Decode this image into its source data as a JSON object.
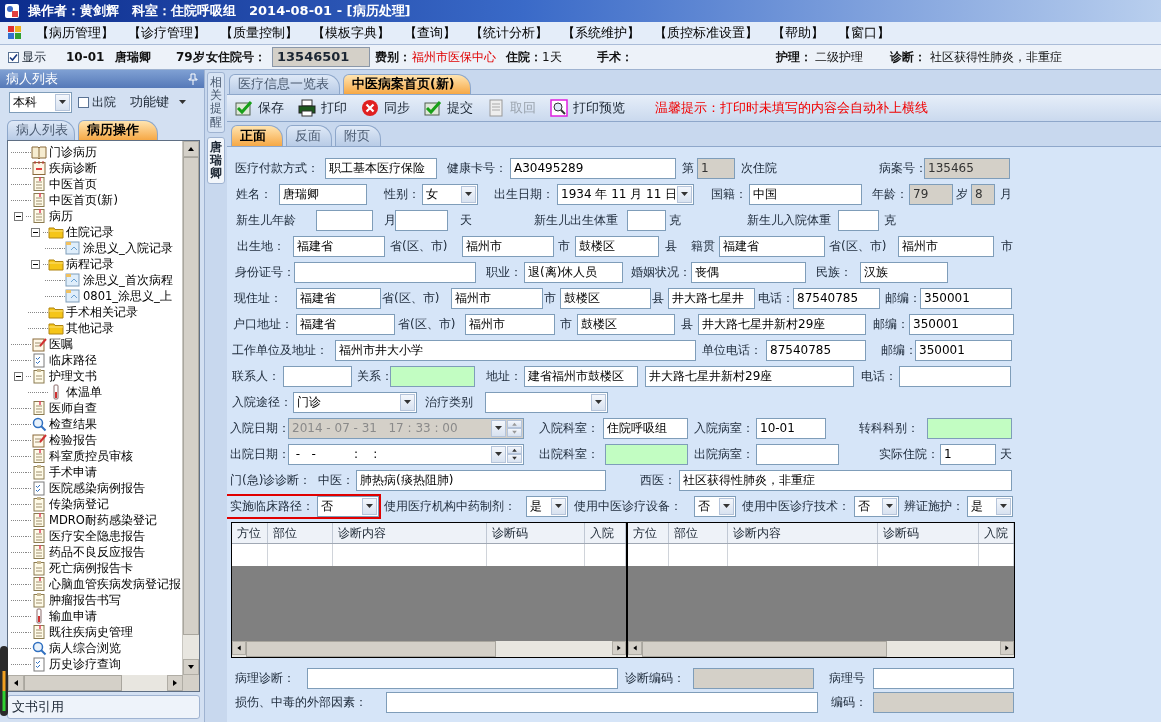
{
  "title_bar": {
    "title": "操作者：黄剑辉　科室：住院呼吸组　2014-08-01 - [病历处理]"
  },
  "menu": [
    "【病历管理】",
    "【诊疗管理】",
    "【质量控制】",
    "【模板字典】",
    "【查询】",
    "【统计分析】",
    "【系统维护】",
    "【质控标准设置】",
    "【帮助】",
    "【窗口】"
  ],
  "patient_bar": {
    "show": {
      "label": "显示",
      "checked": true
    },
    "items": [
      {
        "kind": "label",
        "text": "10-01"
      },
      {
        "kind": "label",
        "text": "唐瑞卿"
      },
      {
        "kind": "label",
        "text": "79岁"
      },
      {
        "kind": "label",
        "text": "女"
      },
      {
        "kind": "label",
        "text": "住院号："
      },
      {
        "kind": "field",
        "text": "13546501"
      },
      {
        "kind": "label",
        "text": "费别："
      },
      {
        "kind": "alert",
        "text": "福州市医保中心"
      },
      {
        "kind": "label",
        "text": "住院："
      },
      {
        "kind": "value",
        "text": "1天"
      },
      {
        "kind": "label",
        "text": "手术："
      },
      {
        "kind": "label",
        "text": "护理："
      },
      {
        "kind": "value",
        "text": "二级护理"
      },
      {
        "kind": "label",
        "text": "诊断："
      },
      {
        "kind": "value",
        "text": "社区获得性肺炎，非重症"
      }
    ]
  },
  "sidebar": {
    "title": "病人列表",
    "filter": {
      "value": "本科"
    },
    "discharged": {
      "label": "出院",
      "checked": false
    },
    "function_key": "功能键",
    "tabs": [
      {
        "label": "病人列表",
        "selected": false
      },
      {
        "label": "病历操作",
        "selected": true
      }
    ],
    "tree": [
      {
        "label": "门诊病历",
        "kind": "book"
      },
      {
        "label": "疾病诊断",
        "kind": "calendar"
      },
      {
        "label": "中医首页",
        "kind": "document"
      },
      {
        "label": "中医首页(新)",
        "kind": "document"
      },
      {
        "label": "病历",
        "kind": "document",
        "expanded": true,
        "children": [
          {
            "label": "住院记录",
            "kind": "folder",
            "expanded": true,
            "children": [
              {
                "label": "涂思义_入院记录",
                "kind": "file"
              }
            ]
          },
          {
            "label": "病程记录",
            "kind": "folder",
            "expanded": true,
            "children": [
              {
                "label": "涂思义_首次病程",
                "kind": "file"
              },
              {
                "label": "0801_涂思义_上",
                "kind": "file"
              }
            ]
          },
          {
            "label": "手术相关记录",
            "kind": "folder"
          },
          {
            "label": "其他记录",
            "kind": "folder"
          }
        ]
      },
      {
        "label": "医嘱",
        "kind": "notepad"
      },
      {
        "label": "临床路径",
        "kind": "checklist"
      },
      {
        "label": "护理文书",
        "kind": "clipboard",
        "expanded": true,
        "children": [
          {
            "label": "体温单",
            "kind": "vial"
          }
        ]
      },
      {
        "label": "医师自查",
        "kind": "document"
      },
      {
        "label": "检查结果",
        "kind": "magnifier"
      },
      {
        "label": "检验报告",
        "kind": "notepad"
      },
      {
        "label": "科室质控员审核",
        "kind": "document"
      },
      {
        "label": "手术申请",
        "kind": "clipboard"
      },
      {
        "label": "医院感染病例报告",
        "kind": "checklist"
      },
      {
        "label": "传染病登记",
        "kind": "clipboard"
      },
      {
        "label": "MDRO耐药感染登记",
        "kind": "document"
      },
      {
        "label": "医疗安全隐患报告",
        "kind": "document"
      },
      {
        "label": "药品不良反应报告",
        "kind": "document"
      },
      {
        "label": "死亡病例报告卡",
        "kind": "clipboard"
      },
      {
        "label": "心脑血管疾病发病登记报",
        "kind": "document"
      },
      {
        "label": "肿瘤报告书写",
        "kind": "clipboard"
      },
      {
        "label": "输血申请",
        "kind": "vial"
      },
      {
        "label": "既往疾病史管理",
        "kind": "document"
      },
      {
        "label": "病人综合浏览",
        "kind": "magnifier"
      },
      {
        "label": "历史诊疗查询",
        "kind": "checklist"
      }
    ],
    "footer": "文书引用"
  },
  "vertical_tabs": [
    {
      "label": "相关提醒",
      "selected": false
    },
    {
      "label": "唐瑞卿",
      "selected": true
    }
  ],
  "doc_tabs": [
    {
      "label": "医疗信息一览表",
      "selected": false
    },
    {
      "label": "中医病案首页(新)",
      "selected": true
    }
  ],
  "toolbar": {
    "buttons": [
      {
        "kind": "save",
        "label": "保存",
        "disabled": false
      },
      {
        "kind": "print",
        "label": "打印",
        "disabled": false
      },
      {
        "kind": "sync",
        "label": "同步",
        "disabled": false
      },
      {
        "kind": "submit",
        "label": "提交",
        "disabled": false
      },
      {
        "kind": "withdraw",
        "label": "取回",
        "disabled": true
      },
      {
        "kind": "preview",
        "label": "打印预览",
        "disabled": false
      }
    ],
    "tip": "温馨提示：打印时未填写的内容会自动补上横线"
  },
  "page_tabs": [
    {
      "label": "正面",
      "selected": true
    },
    {
      "label": "反面",
      "selected": false
    },
    {
      "label": "附页",
      "selected": false
    }
  ],
  "form": {
    "rows": [
      {
        "items": [
          {
            "kind": "label",
            "text": "医疗付款方式："
          },
          {
            "kind": "text",
            "value": "职工基本医疗保险"
          },
          {
            "kind": "label",
            "text": "健康卡号："
          },
          {
            "kind": "text",
            "value": "A30495289"
          },
          {
            "kind": "label",
            "text": "第"
          },
          {
            "kind": "readonly",
            "value": "1"
          },
          {
            "kind": "label",
            "text": "次住院"
          },
          {
            "kind": "label",
            "text": "病案号："
          },
          {
            "kind": "readonly",
            "value": "135465"
          }
        ]
      },
      {
        "items": [
          {
            "kind": "label",
            "text": "姓名："
          },
          {
            "kind": "text",
            "value": "唐瑞卿"
          },
          {
            "kind": "label",
            "text": "性别："
          },
          {
            "kind": "select",
            "value": "女"
          },
          {
            "kind": "label",
            "text": "出生日期："
          },
          {
            "kind": "select",
            "value": "1934 年 11 月 11 日"
          },
          {
            "kind": "label",
            "text": "国籍："
          },
          {
            "kind": "text",
            "value": "中国"
          },
          {
            "kind": "label",
            "text": "年龄："
          },
          {
            "kind": "readonly",
            "value": "79"
          },
          {
            "kind": "label",
            "text": "岁"
          },
          {
            "kind": "readonly",
            "value": "8"
          },
          {
            "kind": "label",
            "text": "月"
          }
        ]
      },
      {
        "items": [
          {
            "kind": "label",
            "text": "新生儿年龄"
          },
          {
            "kind": "text"
          },
          {
            "kind": "label",
            "text": "月"
          },
          {
            "kind": "text"
          },
          {
            "kind": "label",
            "text": "天"
          },
          {
            "kind": "label",
            "text": "新生儿出生体重"
          },
          {
            "kind": "text"
          },
          {
            "kind": "label",
            "text": "克"
          },
          {
            "kind": "label",
            "text": "新生儿入院体重"
          },
          {
            "kind": "text"
          },
          {
            "kind": "label",
            "text": "克"
          }
        ]
      },
      {
        "items": [
          {
            "kind": "label",
            "text": "出生地："
          },
          {
            "kind": "text",
            "value": "福建省"
          },
          {
            "kind": "label",
            "text": "省(区、市)"
          },
          {
            "kind": "text",
            "value": "福州市"
          },
          {
            "kind": "label",
            "text": "市"
          },
          {
            "kind": "text",
            "value": "鼓楼区"
          },
          {
            "kind": "label",
            "text": "县"
          },
          {
            "kind": "label",
            "text": "籍贯"
          },
          {
            "kind": "text",
            "value": "福建省"
          },
          {
            "kind": "label",
            "text": "省(区、市)"
          },
          {
            "kind": "text",
            "value": "福州市"
          },
          {
            "kind": "label",
            "text": "市"
          }
        ]
      },
      {
        "items": [
          {
            "kind": "label",
            "text": "身份证号："
          },
          {
            "kind": "text"
          },
          {
            "kind": "label",
            "text": "职业："
          },
          {
            "kind": "text",
            "value": "退(离)休人员"
          },
          {
            "kind": "label",
            "text": "婚姻状况："
          },
          {
            "kind": "text",
            "value": "丧偶"
          },
          {
            "kind": "label",
            "text": "民族："
          },
          {
            "kind": "text",
            "value": "汉族"
          }
        ]
      },
      {
        "items": [
          {
            "kind": "label",
            "text": "现住址："
          },
          {
            "kind": "text",
            "value": "福建省"
          },
          {
            "kind": "label",
            "text": "省(区、市)"
          },
          {
            "kind": "text",
            "value": "福州市"
          },
          {
            "kind": "label",
            "text": "市"
          },
          {
            "kind": "text",
            "value": "鼓楼区"
          },
          {
            "kind": "label",
            "text": "县"
          },
          {
            "kind": "text",
            "value": "井大路七星井"
          },
          {
            "kind": "label",
            "text": "电话："
          },
          {
            "kind": "text",
            "value": "87540785"
          },
          {
            "kind": "label",
            "text": "邮编："
          },
          {
            "kind": "text",
            "value": "350001"
          }
        ]
      },
      {
        "items": [
          {
            "kind": "label",
            "text": "户口地址："
          },
          {
            "kind": "text",
            "value": "福建省"
          },
          {
            "kind": "label",
            "text": "省(区、市)"
          },
          {
            "kind": "text",
            "value": "福州市"
          },
          {
            "kind": "label",
            "text": "市"
          },
          {
            "kind": "text",
            "value": "鼓楼区"
          },
          {
            "kind": "label",
            "text": "县"
          },
          {
            "kind": "text",
            "value": "井大路七星井新村29座"
          },
          {
            "kind": "label",
            "text": "邮编："
          },
          {
            "kind": "text",
            "value": "350001"
          }
        ]
      },
      {
        "items": [
          {
            "kind": "label",
            "text": "工作单位及地址："
          },
          {
            "kind": "text",
            "value": "福州市井大小学"
          },
          {
            "kind": "label",
            "text": "单位电话："
          },
          {
            "kind": "text",
            "value": "87540785"
          },
          {
            "kind": "label",
            "text": "邮编："
          },
          {
            "kind": "text",
            "value": "350001"
          }
        ]
      },
      {
        "items": [
          {
            "kind": "label",
            "text": "联系人："
          },
          {
            "kind": "text"
          },
          {
            "kind": "label",
            "text": "关系："
          },
          {
            "kind": "picker"
          },
          {
            "kind": "label",
            "text": "地址："
          },
          {
            "kind": "text",
            "value": "建省福州市鼓楼区"
          },
          {
            "kind": "text",
            "value": "井大路七星井新村29座"
          },
          {
            "kind": "label",
            "text": "电话："
          },
          {
            "kind": "text"
          }
        ]
      },
      {
        "items": [
          {
            "kind": "label",
            "text": "入院途径："
          },
          {
            "kind": "select",
            "value": "门诊"
          },
          {
            "kind": "label",
            "text": "治疗类别"
          },
          {
            "kind": "select"
          }
        ]
      },
      {
        "items": [
          {
            "kind": "label",
            "text": "入院日期："
          },
          {
            "kind": "spin",
            "value": "2014 - 07 - 31   17 : 33 : 00",
            "disabled": true
          },
          {
            "kind": "label",
            "text": "入院科室："
          },
          {
            "kind": "text",
            "value": "住院呼吸组"
          },
          {
            "kind": "label",
            "text": "入院病室："
          },
          {
            "kind": "text",
            "value": "10-01"
          },
          {
            "kind": "label",
            "text": "转科科别："
          },
          {
            "kind": "picker"
          }
        ]
      },
      {
        "items": [
          {
            "kind": "label",
            "text": "出院日期："
          },
          {
            "kind": "spin",
            "value": " -   -          :    :",
            "disabled": false
          },
          {
            "kind": "label",
            "text": "出院科室："
          },
          {
            "kind": "picker"
          },
          {
            "kind": "label",
            "text": "出院病室："
          },
          {
            "kind": "text"
          },
          {
            "kind": "label",
            "text": "实际住院："
          },
          {
            "kind": "text",
            "value": "1"
          },
          {
            "kind": "label",
            "text": "天"
          }
        ]
      },
      {
        "items": [
          {
            "kind": "label",
            "text": "门(急)诊诊断："
          },
          {
            "kind": "label",
            "text": "中医："
          },
          {
            "kind": "text",
            "value": "肺热病(痰热阻肺)"
          },
          {
            "kind": "label",
            "text": "西医："
          },
          {
            "kind": "text",
            "value": "社区获得性肺炎，非重症"
          }
        ]
      },
      {
        "items": [
          {
            "kind": "group",
            "highlighted": true,
            "items": [
              {
                "kind": "label",
                "text": "实施临床路径："
              },
              {
                "kind": "select",
                "value": "否"
              }
            ]
          },
          {
            "kind": "label",
            "text": "使用医疗机构中药制剂："
          },
          {
            "kind": "select",
            "value": "是"
          },
          {
            "kind": "label",
            "text": "使用中医诊疗设备："
          },
          {
            "kind": "select",
            "value": "否"
          },
          {
            "kind": "label",
            "text": "使用中医诊疗技术："
          },
          {
            "kind": "select",
            "value": "否"
          },
          {
            "kind": "label",
            "text": "辨证施护："
          },
          {
            "kind": "select",
            "value": "是"
          }
        ]
      }
    ]
  },
  "diagnosis_tables": [
    {
      "columns": [
        "方位",
        "部位",
        "诊断内容",
        "诊断码",
        "入院"
      ]
    },
    {
      "columns": [
        "方位",
        "部位",
        "诊断内容",
        "诊断码",
        "入院"
      ]
    }
  ],
  "form_bottom": {
    "rows": [
      {
        "items": [
          {
            "kind": "label",
            "text": "病理诊断："
          },
          {
            "kind": "text"
          },
          {
            "kind": "label",
            "text": "诊断编码："
          },
          {
            "kind": "readonly"
          },
          {
            "kind": "label",
            "text": "病理号"
          },
          {
            "kind": "text"
          }
        ]
      },
      {
        "items": [
          {
            "kind": "label",
            "text": "损伤、中毒的外部因素："
          },
          {
            "kind": "text"
          },
          {
            "kind": "label",
            "text": "编码："
          },
          {
            "kind": "readonly"
          }
        ]
      }
    ]
  }
}
